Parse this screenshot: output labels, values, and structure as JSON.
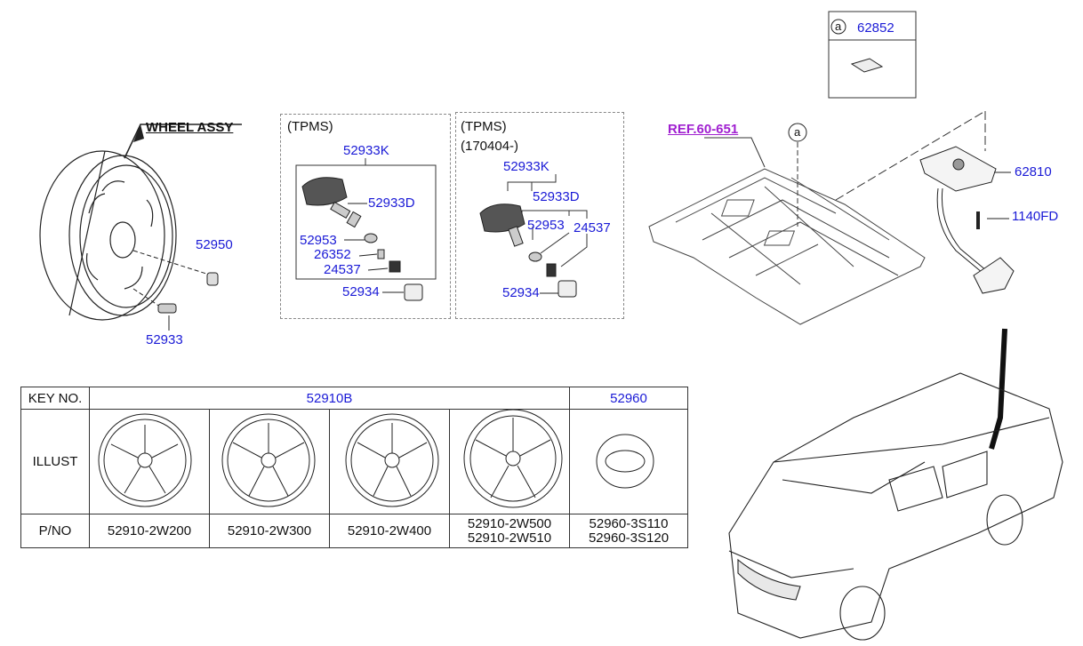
{
  "wheel_assy": {
    "title": "WHEEL ASSY",
    "part_nut": "52950",
    "part_valve": "52933"
  },
  "tpms_left": {
    "heading": "(TPMS)",
    "sensor_kit": "52933K",
    "sensor": "52933D",
    "grommet": "52953",
    "valve_core": "26352",
    "nut": "24537",
    "cap": "52934"
  },
  "tpms_right": {
    "heading": "(TPMS)",
    "date_note": "(170404-)",
    "sensor_kit": "52933K",
    "sensor": "52933D",
    "grommet": "52953",
    "nut": "24537",
    "cap": "52934"
  },
  "floor": {
    "ref": "REF.60-651",
    "callout": "a",
    "carrier": "62810",
    "bolt": "1140FD"
  },
  "inset": {
    "callout": "a",
    "part": "62852"
  },
  "key_table": {
    "col_key": "KEY NO.",
    "group_wheels": "52910B",
    "group_cap": "52960",
    "row_illust": "ILLUST",
    "row_pno": "P/NO",
    "pnos": [
      [
        "52910-2W200"
      ],
      [
        "52910-2W300"
      ],
      [
        "52910-2W400"
      ],
      [
        "52910-2W500",
        "52910-2W510"
      ],
      [
        "52960-3S110",
        "52960-3S120"
      ]
    ]
  }
}
